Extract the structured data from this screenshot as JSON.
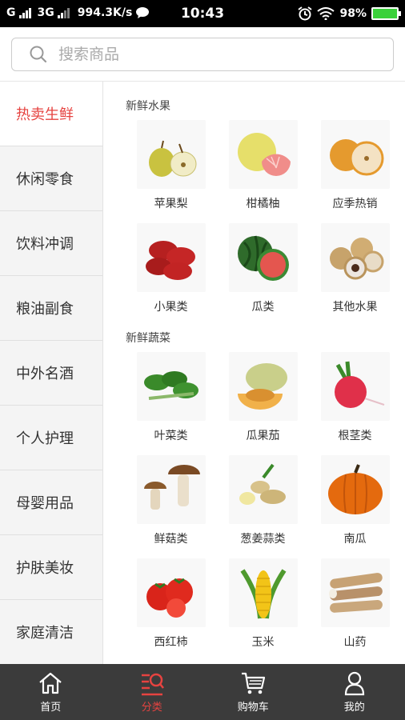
{
  "status_bar": {
    "carrier": "G",
    "network": "3G",
    "speed": "994.3K/s",
    "time": "10:43",
    "battery": "98%"
  },
  "search": {
    "placeholder": "搜索商品"
  },
  "sidebar": {
    "items": [
      {
        "label": "热卖生鲜",
        "active": true
      },
      {
        "label": "休闲零食"
      },
      {
        "label": "饮料冲调"
      },
      {
        "label": "粮油副食"
      },
      {
        "label": "中外名酒"
      },
      {
        "label": "个人护理"
      },
      {
        "label": "母婴用品"
      },
      {
        "label": "护肤美妆"
      },
      {
        "label": "家庭清洁"
      }
    ]
  },
  "content": {
    "sections": [
      {
        "title": "新鲜水果",
        "items": [
          {
            "label": "苹果梨",
            "icon": "pear-icon"
          },
          {
            "label": "柑橘柚",
            "icon": "pomelo-icon"
          },
          {
            "label": "应季热销",
            "icon": "asian-pear-icon"
          },
          {
            "label": "小果类",
            "icon": "jujube-icon"
          },
          {
            "label": "瓜类",
            "icon": "watermelon-icon"
          },
          {
            "label": "其他水果",
            "icon": "longan-icon"
          }
        ]
      },
      {
        "title": "新鲜蔬菜",
        "items": [
          {
            "label": "叶菜类",
            "icon": "spinach-icon"
          },
          {
            "label": "瓜果茄",
            "icon": "melon-icon"
          },
          {
            "label": "根茎类",
            "icon": "radish-icon"
          },
          {
            "label": "鲜菇类",
            "icon": "mushroom-icon"
          },
          {
            "label": "葱姜蒜类",
            "icon": "ginger-icon"
          },
          {
            "label": "南瓜",
            "icon": "pumpkin-icon"
          },
          {
            "label": "西红柿",
            "icon": "tomato-icon"
          },
          {
            "label": "玉米",
            "icon": "corn-icon"
          },
          {
            "label": "山药",
            "icon": "yam-icon"
          }
        ]
      }
    ]
  },
  "tabbar": {
    "tabs": [
      {
        "label": "首页",
        "icon": "home-icon"
      },
      {
        "label": "分类",
        "icon": "category-icon",
        "active": true
      },
      {
        "label": "购物车",
        "icon": "cart-icon"
      },
      {
        "label": "我的",
        "icon": "user-icon"
      }
    ]
  },
  "colors": {
    "accent": "#e64340",
    "tabbar_bg": "#3b3b3b",
    "sidebar_bg": "#f4f4f4"
  }
}
